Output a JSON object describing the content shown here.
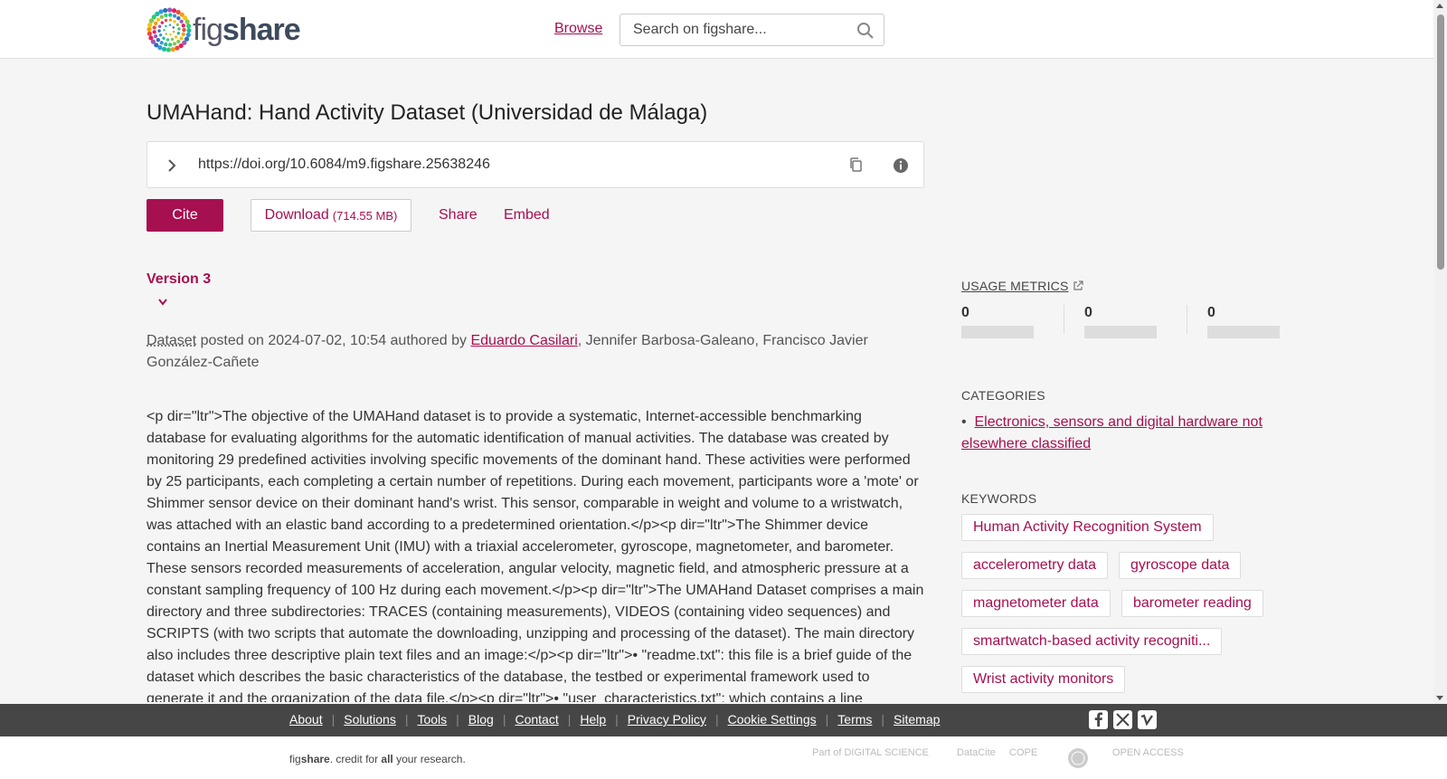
{
  "header": {
    "logo_prefix": "fig",
    "logo_suffix": "share",
    "browse_label": "Browse",
    "search_placeholder": "Search on figshare..."
  },
  "item": {
    "title": "UMAHand: Hand Activity Dataset (Universidad de Málaga)",
    "doi_url": "https://doi.org/10.6084/m9.figshare.25638246",
    "cite_label": "Cite",
    "download_label": "Download",
    "download_size": "(714.55 MB)",
    "share_label": "Share",
    "embed_label": "Embed",
    "version_label": "Version 3",
    "type": "Dataset",
    "posted_text": " posted on 2024-07-02, 10:54 authored by ",
    "author_link": "Eduardo Casilari",
    "other_authors": ", Jennifer Barbosa-Galeano, Francisco Javier González-Cañete",
    "description": "<p dir=\"ltr\">The objective of the UMAHand dataset is to provide a systematic, Internet-accessible benchmarking database for evaluating algorithms for the automatic identification of manual activities. The database was created by monitoring 29 predefined activities involving specific movements of the dominant hand. These activities were performed by 25 participants, each completing a certain number of repetitions. During each movement, participants wore a 'mote' or Shimmer sensor device on their dominant hand's wrist. This sensor, comparable in weight and volume to a wristwatch, was attached with an elastic band according to a predetermined orientation.</p><p dir=\"ltr\">The Shimmer device contains an Inertial Measurement Unit (IMU) with a triaxial accelerometer, gyroscope, magnetometer, and barometer. These sensors recorded measurements of acceleration, angular velocity, magnetic field, and atmospheric pressure at a constant sampling frequency of 100 Hz during each movement.</p><p dir=\"ltr\">The UMAHand Dataset comprises a main directory and three subdirectories: TRACES (containing measurements), VIDEOS (containing video sequences) and SCRIPTS (with two scripts that automate the downloading, unzipping and processing of the dataset). The main directory also includes three descriptive plain text files and an image:</p><p dir=\"ltr\">• \"readme.txt\": this file is a brief guide of the dataset which describes the basic characteristics of the database, the testbed or experimental framework used to generate it and the organization of the data file.</p><p dir=\"ltr\">• \"user_characteristics.txt\": which contains a line"
  },
  "sidebar": {
    "metrics_title": "USAGE METRICS",
    "metrics": [
      "0",
      "0",
      "0"
    ],
    "categories_title": "CATEGORIES",
    "bullet": "•",
    "category": "Electronics, sensors and digital hardware not elsewhere classified",
    "keywords_title": "KEYWORDS",
    "keywords": [
      "Human Activity Recognition System",
      "accelerometry data",
      "gyroscope data",
      "magnetometer data",
      "barometer reading",
      "smartwatch-based activity recogniti...",
      "Wrist activity monitors"
    ]
  },
  "footer": {
    "links": [
      "About",
      "Solutions",
      "Tools",
      "Blog",
      "Contact",
      "Help",
      "Privacy Policy",
      "Cookie Settings",
      "Terms",
      "Sitemap"
    ],
    "tagline_a": "fig",
    "tagline_b": "share",
    "tagline_c": ". credit for ",
    "tagline_d": "all",
    "tagline_e": " your research.",
    "partner_digital_science": "Part of DIGITAL SCIENCE",
    "partner_datacite": "DataCite",
    "partner_cope": "COPE",
    "partner_open_access": "OPEN ACCESS"
  },
  "colors": {
    "accent": "#a60f50",
    "footer_bg": "#464646",
    "page_bg": "#f5f5f5"
  },
  "icons": [
    "figshare-logo-icon",
    "search-icon",
    "chevron-right-icon",
    "copy-icon",
    "info-icon",
    "chevron-down-icon",
    "external-link-icon",
    "facebook-icon",
    "x-icon",
    "vimeo-icon"
  ]
}
